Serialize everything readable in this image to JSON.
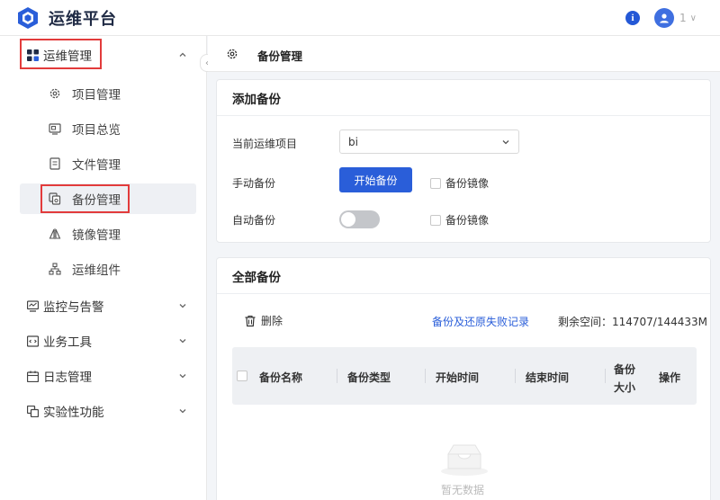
{
  "app": {
    "title": "运维平台",
    "user": "1"
  },
  "sidebar": {
    "groups": [
      {
        "label": "运维管理",
        "icon": "grid-icon"
      },
      {
        "label": "监控与告警",
        "icon": "monitor-icon"
      },
      {
        "label": "业务工具",
        "icon": "code-window-icon"
      },
      {
        "label": "日志管理",
        "icon": "calendar-icon"
      },
      {
        "label": "实验性功能",
        "icon": "layers-icon"
      }
    ],
    "items": [
      {
        "label": "项目管理",
        "icon": "gear-icon"
      },
      {
        "label": "项目总览",
        "icon": "overview-icon"
      },
      {
        "label": "文件管理",
        "icon": "document-icon"
      },
      {
        "label": "备份管理",
        "icon": "backup-icon"
      },
      {
        "label": "镜像管理",
        "icon": "mirror-icon"
      },
      {
        "label": "运维组件",
        "icon": "hierarchy-icon"
      }
    ]
  },
  "header": {
    "title": "备份管理"
  },
  "add_backup": {
    "title": "添加备份",
    "project_label": "当前运维项目",
    "project_value": "bi",
    "manual_label": "手动备份",
    "start_button": "开始备份",
    "image_checkbox": "备份镜像",
    "auto_label": "自动备份",
    "auto_image_checkbox": "备份镜像",
    "auto_enabled": false
  },
  "all_backups": {
    "title": "全部备份",
    "delete_label": "删除",
    "fail_link": "备份及还原失败记录",
    "space_info": "剩余空间：114707/144433M",
    "columns": [
      "备份名称",
      "备份类型",
      "开始时间",
      "结束时间",
      "备份大小",
      "操作"
    ],
    "empty_text": "暂无数据"
  },
  "colors": {
    "primary": "#2a5ed9",
    "highlight": "#e23b3b"
  }
}
